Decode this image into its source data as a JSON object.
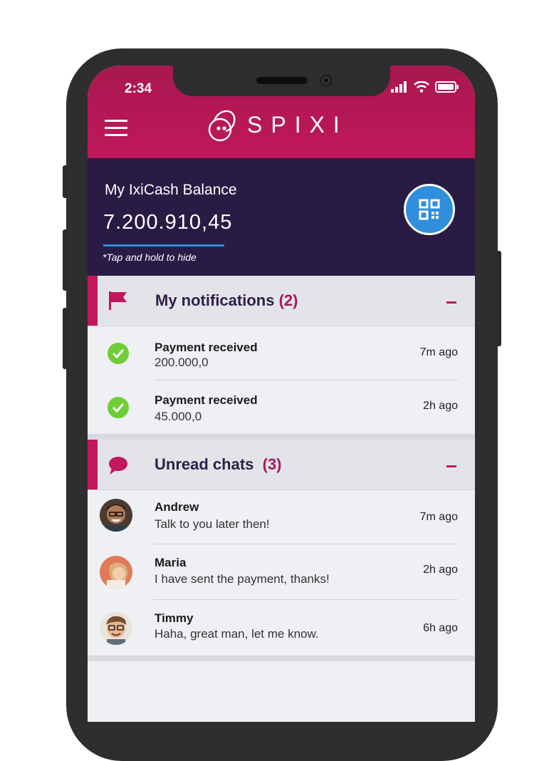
{
  "status_bar": {
    "time": "2:34"
  },
  "header": {
    "logo_text": "SPIXI"
  },
  "balance": {
    "title": "My IxiCash Balance",
    "amount": "7.200.910,45",
    "hint": "*Tap and hold to hide"
  },
  "notifications": {
    "title": "My notifications",
    "count": "(2)",
    "items": [
      {
        "title": "Payment received",
        "amount": "200.000,0",
        "time": "7m ago"
      },
      {
        "title": "Payment received",
        "amount": "45.000,0",
        "time": "2h ago"
      }
    ]
  },
  "chats": {
    "title": "Unread chats",
    "count": "(3)",
    "items": [
      {
        "name": "Andrew",
        "message": "Talk to you later then!",
        "time": "7m ago"
      },
      {
        "name": "Maria",
        "message": "I have sent the payment, thanks!",
        "time": "2h ago"
      },
      {
        "name": "Timmy",
        "message": "Haha, great man, let me know.",
        "time": "6h ago"
      }
    ]
  },
  "colors": {
    "brand": "#c0185a",
    "balance_bg": "#281c44",
    "accent_blue": "#2f8fdd",
    "success": "#6fce35"
  },
  "icons": [
    "hamburger-icon",
    "signal-icon",
    "wifi-icon",
    "battery-icon",
    "qr-code-icon",
    "flag-icon",
    "chat-bubble-icon",
    "checkmark-icon"
  ]
}
